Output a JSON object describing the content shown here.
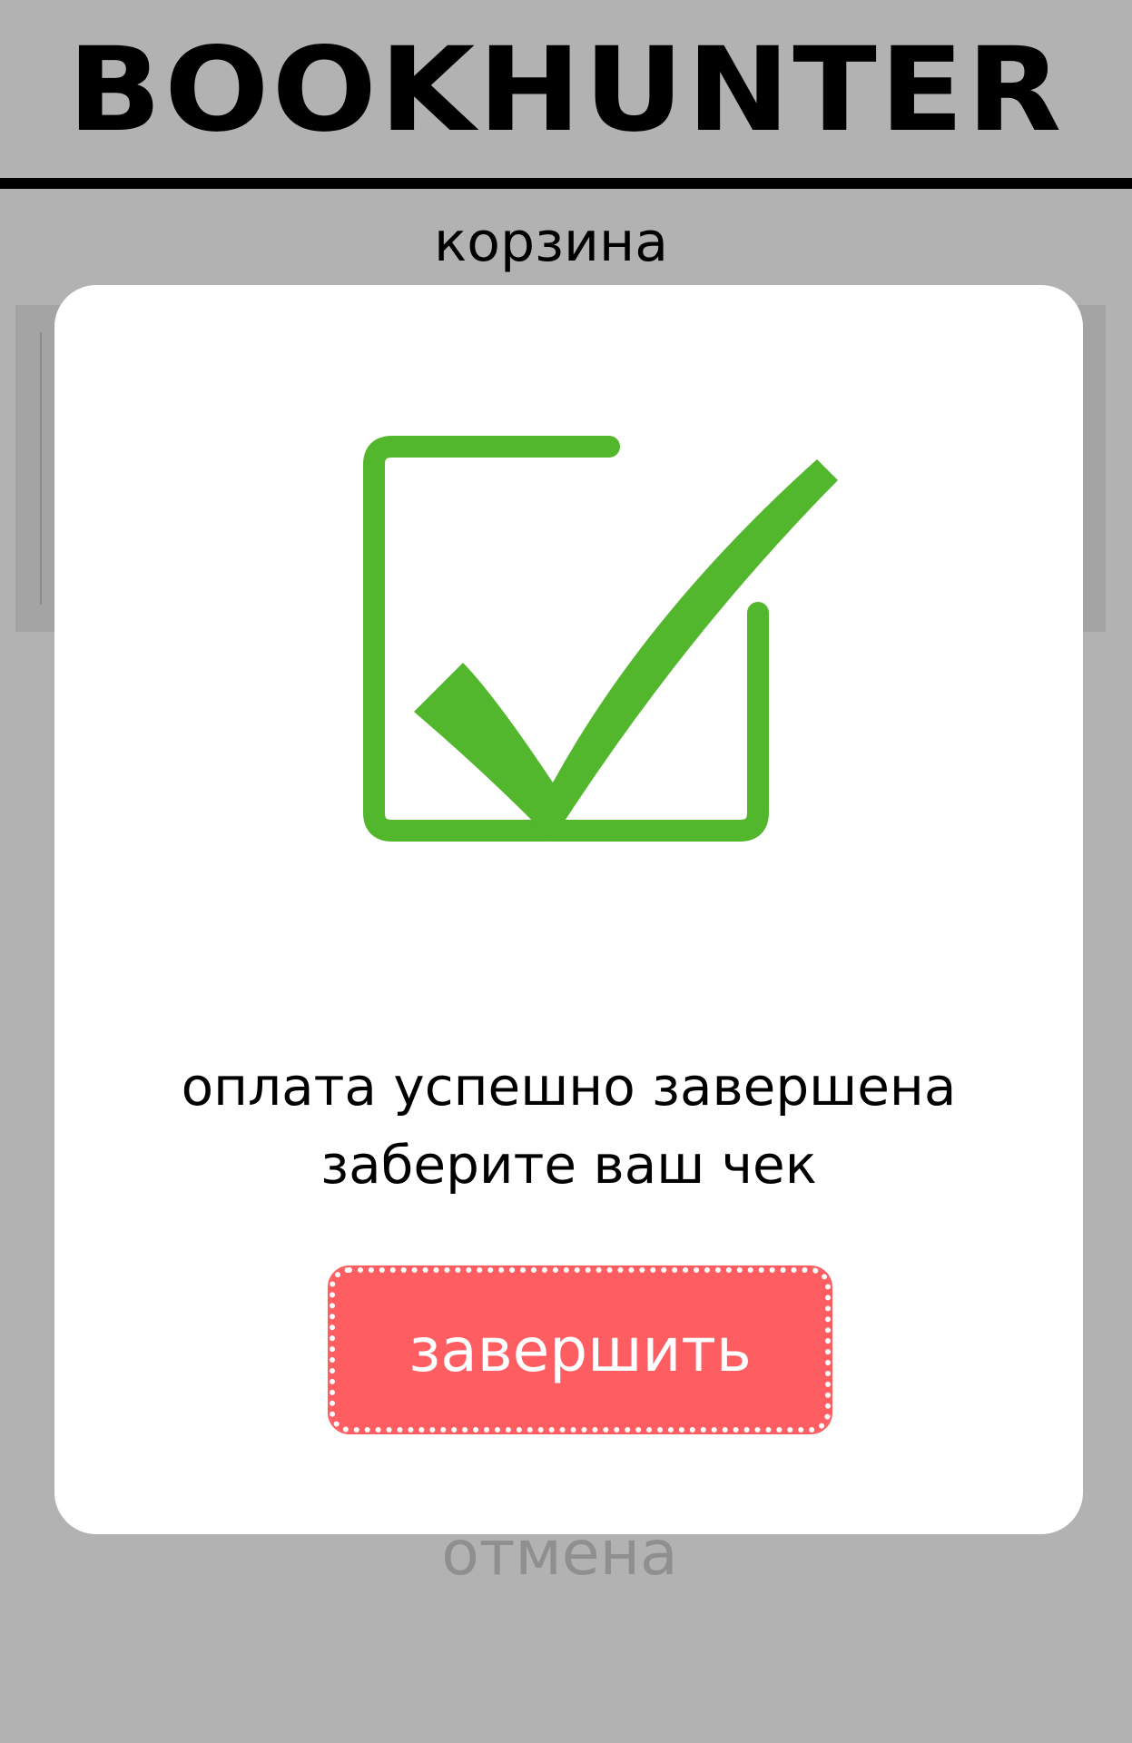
{
  "header": {
    "logo": "BOOKHUNTER"
  },
  "cart": {
    "title": "корзина",
    "cancel_label": "отмена"
  },
  "modal": {
    "icon": "checkbox-check-icon",
    "message_line1": "оплата успешно завершена",
    "message_line2": "заберите ваш чек",
    "finish_label": "завершить"
  },
  "colors": {
    "background": "#b2b2b2",
    "check_green": "#52b72d",
    "button_red": "#fe5e61",
    "modal_bg": "#ffffff",
    "cancel_text": "#8f8f8f"
  }
}
